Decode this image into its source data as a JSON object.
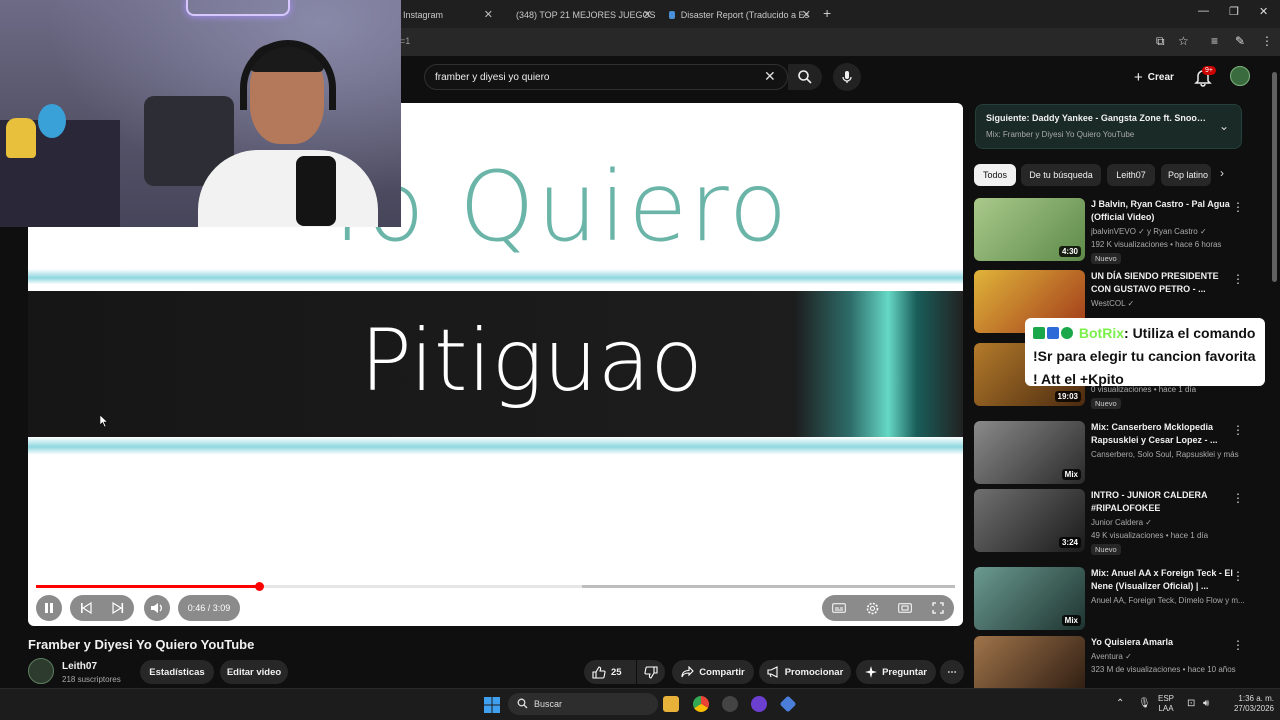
{
  "browser": {
    "tabs": [
      {
        "label": "Instagram",
        "color": "#c13584"
      },
      {
        "label": "(348) TOP 21 MEJORES JUEGOS",
        "color": "#ff0000"
      },
      {
        "label": "Disaster Report (Traducido a Es",
        "color": "#4a90d9"
      }
    ],
    "address_fragment": "=1",
    "new_tab_icon": "plus-icon"
  },
  "header": {
    "search_value": "framber y diyesi yo quiero",
    "create_label": "Crear",
    "notif_count": "9+"
  },
  "player": {
    "text_line1": "Yo Quiero",
    "text_line2": "Pitiguao",
    "current_time": "0:46",
    "total_time": "3:09",
    "time_display": "0:46 / 3:09",
    "progress_fraction": 0.243,
    "buffered_fraction": 0.594
  },
  "video": {
    "title": "Framber y Diyesi Yo Quiero YouTube",
    "channel": "Leith07",
    "subscribers": "218 suscriptores",
    "stats_label": "Estadísticas",
    "edit_label": "Editar video",
    "likes": "25",
    "share_label": "Compartir",
    "promote_label": "Promocionar",
    "ask_label": "Preguntar"
  },
  "sidebar": {
    "next_title": "Siguiente: Daddy Yankee - Gangsta Zone ft. Snoop ...",
    "next_sub": "Mix: Framber y Diyesi Yo Quiero YouTube",
    "chips": [
      "Todos",
      "De tu búsqueda",
      "Leith07",
      "Pop latino"
    ],
    "items": [
      {
        "title": "J Balvin, Ryan Castro - Pal Agua (Official Video)",
        "channel": "jbalvinVEVO ✓ y Ryan Castro ✓",
        "meta": "192 K visualizaciones • hace 6 horas",
        "badge": "Nuevo",
        "duration": "4:30",
        "thumb": "#7da86a"
      },
      {
        "title": "UN DÍA SIENDO PRESIDENTE CON GUSTAVO PETRO - ...",
        "channel": "WestCOL ✓",
        "meta": "",
        "badge": "",
        "duration": "",
        "thumb": "#c89a2a"
      },
      {
        "title": "",
        "channel": "",
        "meta": "0 visualizaciones • hace 1 día",
        "badge": "Nuevo",
        "duration": "19:03",
        "thumb": "#8a5a2a"
      },
      {
        "title": "Mix: Canserbero Mcklopedia Rapsusklei y Cesar Lopez - ...",
        "channel": "Canserbero, Solo Soul, Rapsusklei y más",
        "meta": "",
        "badge": "",
        "duration": "Mix",
        "thumb": "#6a6a6a"
      },
      {
        "title": "INTRO - JUNIOR CALDERA #RIPALOFOKEE",
        "channel": "Junior Caldera ✓",
        "meta": "49 K visualizaciones • hace 1 día",
        "badge": "Nuevo",
        "duration": "3:24",
        "thumb": "#3a3a3a"
      },
      {
        "title": "Mix: Anuel AA x Foreign Teck - El Nene (Visualizer Oficial) | ...",
        "channel": "Anuel AA, Foreign Teck, Dímelo Flow y m...",
        "meta": "",
        "badge": "",
        "duration": "Mix",
        "thumb": "#3f5c55"
      },
      {
        "title": "Yo Quisiera Amarla",
        "channel": "Aventura ✓",
        "meta": "323 M de visualizaciones • hace 10 años",
        "badge": "",
        "duration": "",
        "thumb": "#5a4030"
      }
    ]
  },
  "chat_overlay": {
    "name": "BotRix",
    "message": ": Utiliza el comando !Sr para elegir tu cancion favorita ! Att el +Kpito"
  },
  "taskbar": {
    "search_label": "Buscar",
    "lang_top": "ESP",
    "lang_bottom": "LAA",
    "time": "1:36 a. m.",
    "date": "27/03/2026"
  }
}
